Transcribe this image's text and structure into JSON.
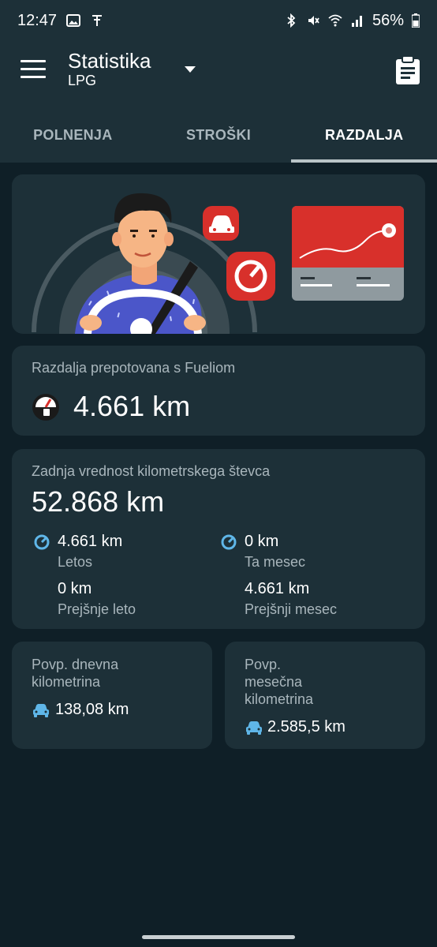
{
  "status": {
    "time": "12:47",
    "battery": "56%"
  },
  "appbar": {
    "title": "Statistika",
    "subtitle": "LPG",
    "menu_icon": "hamburger-menu-icon",
    "dropdown_icon": "caret-down-icon",
    "report_icon": "clipboard-icon"
  },
  "tabs": [
    {
      "label": "POLNENJA",
      "active": false
    },
    {
      "label": "STROŠKI",
      "active": false
    },
    {
      "label": "RAZDALJA",
      "active": true
    }
  ],
  "distance": {
    "label": "Razdalja prepotovana s Fueliom",
    "value": "4.661 km",
    "icon": "fuel-gauge-icon"
  },
  "odometer": {
    "label": "Zadnja vrednost kilometrskega števca",
    "value": "52.868 km",
    "stats": [
      {
        "value": "4.661 km",
        "label": "Letos",
        "icon": "speedometer-icon"
      },
      {
        "value": "0 km",
        "label": "Ta mesec",
        "icon": "speedometer-icon"
      },
      {
        "value": "0 km",
        "label": "Prejšnje leto",
        "icon": ""
      },
      {
        "value": "4.661 km",
        "label": "Prejšnji mesec",
        "icon": ""
      }
    ]
  },
  "avg_daily": {
    "label": "Povp. dnevna kilometrina",
    "value": "138,08 km",
    "icon": "car-icon"
  },
  "avg_monthly": {
    "label": "Povp. mesečna kilometrina",
    "value": "2.585,5 km",
    "icon": "car-icon"
  },
  "colors": {
    "background": "#0f1f27",
    "card": "#1d3038",
    "accent_red": "#d8302b",
    "icon_blue": "#5fb6e8"
  }
}
